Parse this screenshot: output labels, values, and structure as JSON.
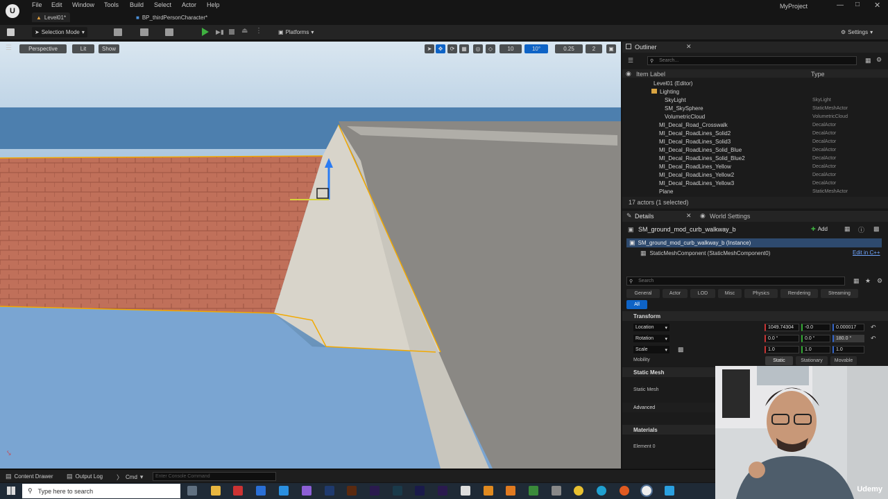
{
  "menu": [
    "File",
    "Edit",
    "Window",
    "Tools",
    "Build",
    "Select",
    "Actor",
    "Help"
  ],
  "project_name": "MyProject",
  "tabs": [
    "Level01*",
    "BP_thirdPersonCharacter*"
  ],
  "toolbar": {
    "mode": "Selection Mode",
    "platforms": "Platforms",
    "settings": "Settings"
  },
  "viewport": {
    "perspective": "Perspective",
    "lit": "Lit",
    "show": "Show",
    "grid": "10",
    "angle": "10°",
    "scale": "0.25",
    "cam": "2"
  },
  "outliner": {
    "title": "Outliner",
    "search_placeholder": "Search...",
    "col_label": "Item Label",
    "col_type": "Type",
    "rows": [
      {
        "name": "Level01 (Editor)",
        "type": ""
      },
      {
        "name": "Lighting",
        "type": ""
      },
      {
        "name": "SkyLight",
        "type": "SkyLight"
      },
      {
        "name": "SM_SkySphere",
        "type": "StaticMeshActor"
      },
      {
        "name": "VolumetricCloud",
        "type": "VolumetricCloud"
      },
      {
        "name": "MI_Decal_Road_Crosswalk",
        "type": "DecalActor"
      },
      {
        "name": "MI_Decal_RoadLines_Solid2",
        "type": "DecalActor"
      },
      {
        "name": "MI_Decal_RoadLines_Solid3",
        "type": "DecalActor"
      },
      {
        "name": "MI_Decal_RoadLines_Solid_Blue",
        "type": "DecalActor"
      },
      {
        "name": "MI_Decal_RoadLines_Solid_Blue2",
        "type": "DecalActor"
      },
      {
        "name": "MI_Decal_RoadLines_Yellow",
        "type": "DecalActor"
      },
      {
        "name": "MI_Decal_RoadLines_Yellow2",
        "type": "DecalActor"
      },
      {
        "name": "MI_Decal_RoadLines_Yellow3",
        "type": "DecalActor"
      },
      {
        "name": "Plane",
        "type": "StaticMeshActor"
      }
    ],
    "count": "17 actors (1 selected)"
  },
  "details": {
    "title": "Details",
    "world_settings": "World Settings",
    "actor_name": "SM_ground_mod_curb_walkway_b",
    "add": "Add",
    "instance": "SM_ground_mod_curb_walkway_b (Instance)",
    "component": "StaticMeshComponent (StaticMeshComponent0)",
    "edit_cpp": "Edit in C++",
    "search_placeholder": "Search",
    "filter_tabs": [
      "General",
      "Actor",
      "LOD",
      "Misc",
      "Physics",
      "Rendering",
      "Streaming"
    ],
    "all": "All",
    "transform": "Transform",
    "location_label": "Location",
    "location": [
      "1049.74304",
      "-0.0",
      "0.000017"
    ],
    "rotation_label": "Rotation",
    "rotation": [
      "0.0 °",
      "0.0 °",
      "180.0 °"
    ],
    "scale_label": "Scale",
    "scale": [
      "1.0",
      "1.0",
      "1.0"
    ],
    "mobility_label": "Mobility",
    "mobility": [
      "Static",
      "Stationary",
      "Movable"
    ],
    "static_mesh_section": "Static Mesh",
    "static_mesh_label": "Static Mesh",
    "advanced": "Advanced",
    "materials": "Materials",
    "element0": "Element 0"
  },
  "status": {
    "content_drawer": "Content Drawer",
    "output_log": "Output Log",
    "cmd": "Cmd",
    "console_placeholder": "Enter Console Command"
  },
  "taskbar": {
    "search": "Type here to search"
  },
  "watermark": "Udemy",
  "colors": {
    "accent": "#0e63c6",
    "selection": "#f2a900",
    "play": "#3fb040"
  }
}
